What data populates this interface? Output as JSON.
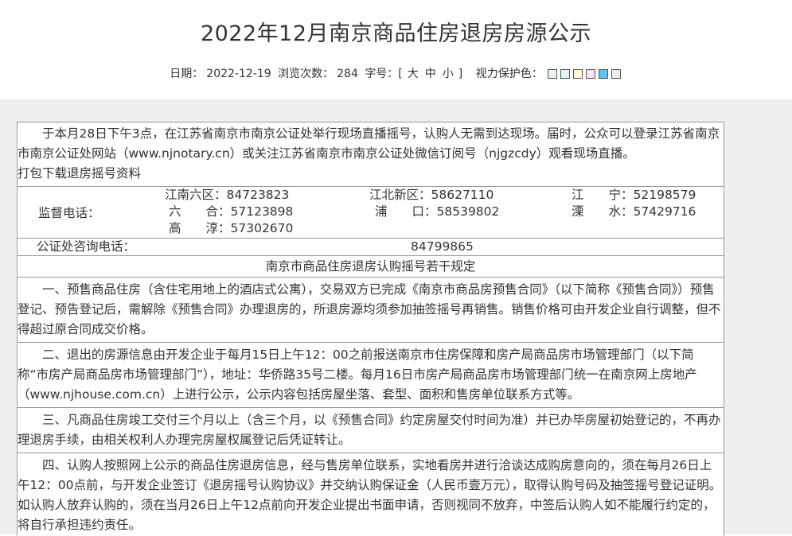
{
  "header": {
    "title": "2022年12月南京商品住房退房房源公示",
    "date_label": "日期：",
    "date": "2022-12-19",
    "views_label": "浏览次数：",
    "views": "284",
    "font_label": "字号：[",
    "font_large": "大",
    "font_medium": "中",
    "font_small": "小",
    "font_close": "]",
    "eye_label": "视力保护色：",
    "swatches": [
      "#e8f4f7",
      "#dff7f3",
      "#fdfbd2",
      "#f9e3f7",
      "#5ec3f0",
      "#eeeeee"
    ]
  },
  "intro": {
    "text": "于本月28日下午3点，在江苏省南京市南京公证处举行现场直播摇号，认购人无需到达现场。届时，公众可以登录江苏省南京市南京公证处网站（www.njnotary.cn）或关注江苏省南京市南京公证处微信订阅号（njgzcdy）观看现场直播。",
    "download": "打包下载退房摇号资料"
  },
  "supervision": {
    "label": "监督电话：",
    "cells": [
      "江南六区：84723823",
      "江北新区：58627110",
      "江　　宁：52198579",
      "六　　合：57123898",
      "浦　　口：58539802",
      "溧　　水：57429716",
      "高　　淳：57302670"
    ]
  },
  "notary": {
    "label": "公证处咨询电话：",
    "number": "84799865"
  },
  "rules": {
    "title": "南京市商品住房退房认购摇号若干规定",
    "paragraphs": [
      "一、预售商品住房（含住宅用地上的酒店式公寓），交易双方已完成《南京市商品房预售合同》（以下简称《预售合同》）预售登记、预告登记后，需解除《预售合同》办理退房的，所退房源均须参加抽签摇号再销售。销售价格可由开发企业自行调整，但不得超过原合同成交价格。",
      "二、退出的房源信息由开发企业于每月15日上午12：00之前报送南京市住房保障和房产局商品房市场管理部门（以下简称“市房产局商品房市场管理部门”），地址：华侨路35号二楼。每月16日市房产局商品房市场管理部门统一在南京网上房地产（www.njhouse.com.cn）上进行公示，公示内容包括房屋坐落、套型、面积和售房单位联系方式等。",
      "三、凡商品住房竣工交付三个月以上（含三个月，以《预售合同》约定房屋交付时间为准）并已办毕房屋初始登记的，不再办理退房手续，由相关权利人办理完房屋权属登记后凭证转让。",
      "四、认购人按照网上公示的商品住房退房信息，经与售房单位联系，实地看房并进行洽谈达成购房意向的，须在每月26日上午12：00点前，与开发企业签订《退房摇号认购协议》并交纳认购保证金（人民币壹万元），取得认购号码及抽签摇号登记证明。如认购人放弃认购的，须在当月26日上午12点前向开发企业提出书面申请，否则视同不放弃，中签后认购人如不能履行约定的，将自行承担违约责任。"
    ]
  }
}
